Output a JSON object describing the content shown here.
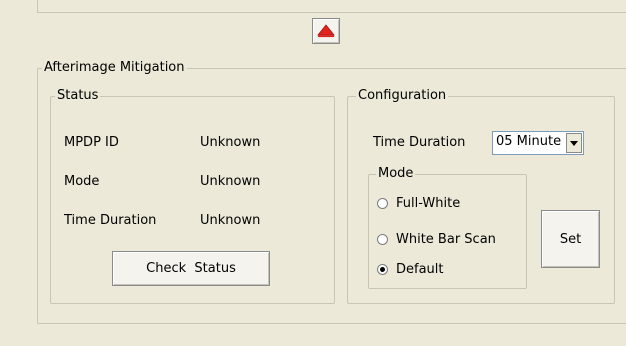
{
  "collapse_button": {
    "icon": "triangle-up-icon",
    "color": "#e0251e"
  },
  "afterimage": {
    "title": "Afterimage  Mitigation",
    "status": {
      "title": "Status",
      "rows": [
        {
          "label": "MPDP ID",
          "value": "Unknown"
        },
        {
          "label": "Mode",
          "value": "Unknown"
        },
        {
          "label": "Time Duration",
          "value": "Unknown"
        }
      ],
      "check_button": "Check  Status"
    },
    "configuration": {
      "title": "Configuration",
      "time_duration_label": "Time Duration",
      "time_duration_value": "05 Minute",
      "mode": {
        "title": "Mode",
        "options": [
          {
            "label": "Full-White",
            "checked": false
          },
          {
            "label": "White Bar Scan",
            "checked": false
          },
          {
            "label": "Default",
            "checked": true
          }
        ]
      },
      "set_button": "Set"
    }
  }
}
